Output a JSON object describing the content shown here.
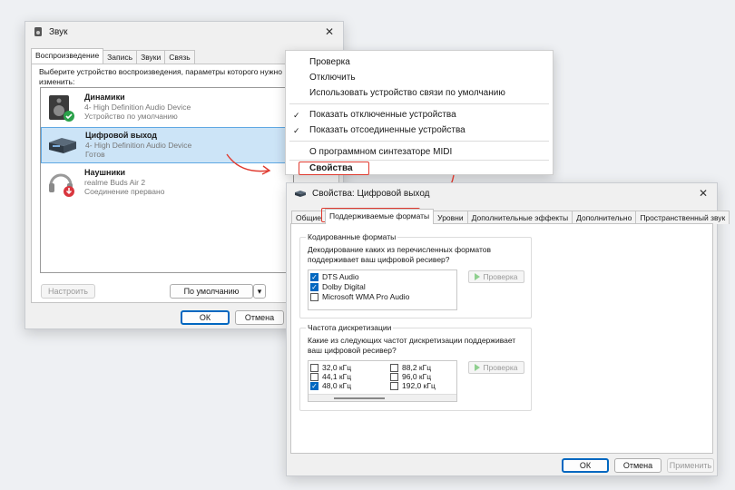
{
  "sound": {
    "title": "Звук",
    "tabs": [
      "Воспроизведение",
      "Запись",
      "Звуки",
      "Связь"
    ],
    "description": "Выберите устройство воспроизведения, параметры которого нужно изменить:",
    "devices": [
      {
        "name": "Динамики",
        "line1": "4- High Definition Audio Device",
        "line2": "Устройство по умолчанию"
      },
      {
        "name": "Цифровой выход",
        "line1": "4- High Definition Audio Device",
        "line2": "Готов"
      },
      {
        "name": "Наушники",
        "line1": "realme Buds Air 2",
        "line2": "Соединение прервано"
      }
    ],
    "configure": "Настроить",
    "default": "По умолчанию",
    "ok": "ОК",
    "cancel": "Отмена"
  },
  "menu": {
    "items": [
      "Проверка",
      "Отключить",
      "Использовать устройство связи по умолчанию"
    ],
    "checked": [
      "Показать отключенные устройства",
      "Показать отсоединенные устройства"
    ],
    "midi": "О программном синтезаторе MIDI",
    "properties": "Свойства",
    "check_mark": "✓"
  },
  "props": {
    "title": "Свойства: Цифровой выход",
    "tabs": [
      "Общие",
      "Поддерживаемые форматы",
      "Уровни",
      "Дополнительные эффекты",
      "Дополнительно",
      "Пространственный звук"
    ],
    "group1": {
      "title": "Кодированные форматы",
      "question": "Декодирование каких из перечисленных форматов поддерживает ваш цифровой ресивер?",
      "formats": [
        {
          "label": "DTS Audio",
          "checked": true
        },
        {
          "label": "Dolby Digital",
          "checked": true
        },
        {
          "label": "Microsoft WMA Pro Audio",
          "checked": false
        }
      ],
      "test": "Проверка"
    },
    "group2": {
      "title": "Частота дискретизации",
      "question": "Какие из следующих частот дискретизации поддерживает ваш цифровой ресивер?",
      "rates_left": [
        {
          "label": "32,0 кГц",
          "checked": false
        },
        {
          "label": "44,1 кГц",
          "checked": false
        },
        {
          "label": "48,0 кГц",
          "checked": true
        }
      ],
      "rates_right": [
        {
          "label": "88,2 кГц",
          "checked": false
        },
        {
          "label": "96,0 кГц",
          "checked": false
        },
        {
          "label": "192,0 кГц",
          "checked": false
        }
      ],
      "test": "Проверка"
    },
    "ok": "ОК",
    "cancel": "Отмена",
    "apply": "Применить"
  },
  "colors": {
    "accent": "#0067c0",
    "highlight": "#e03a2f",
    "selection": "#cce4f7"
  }
}
